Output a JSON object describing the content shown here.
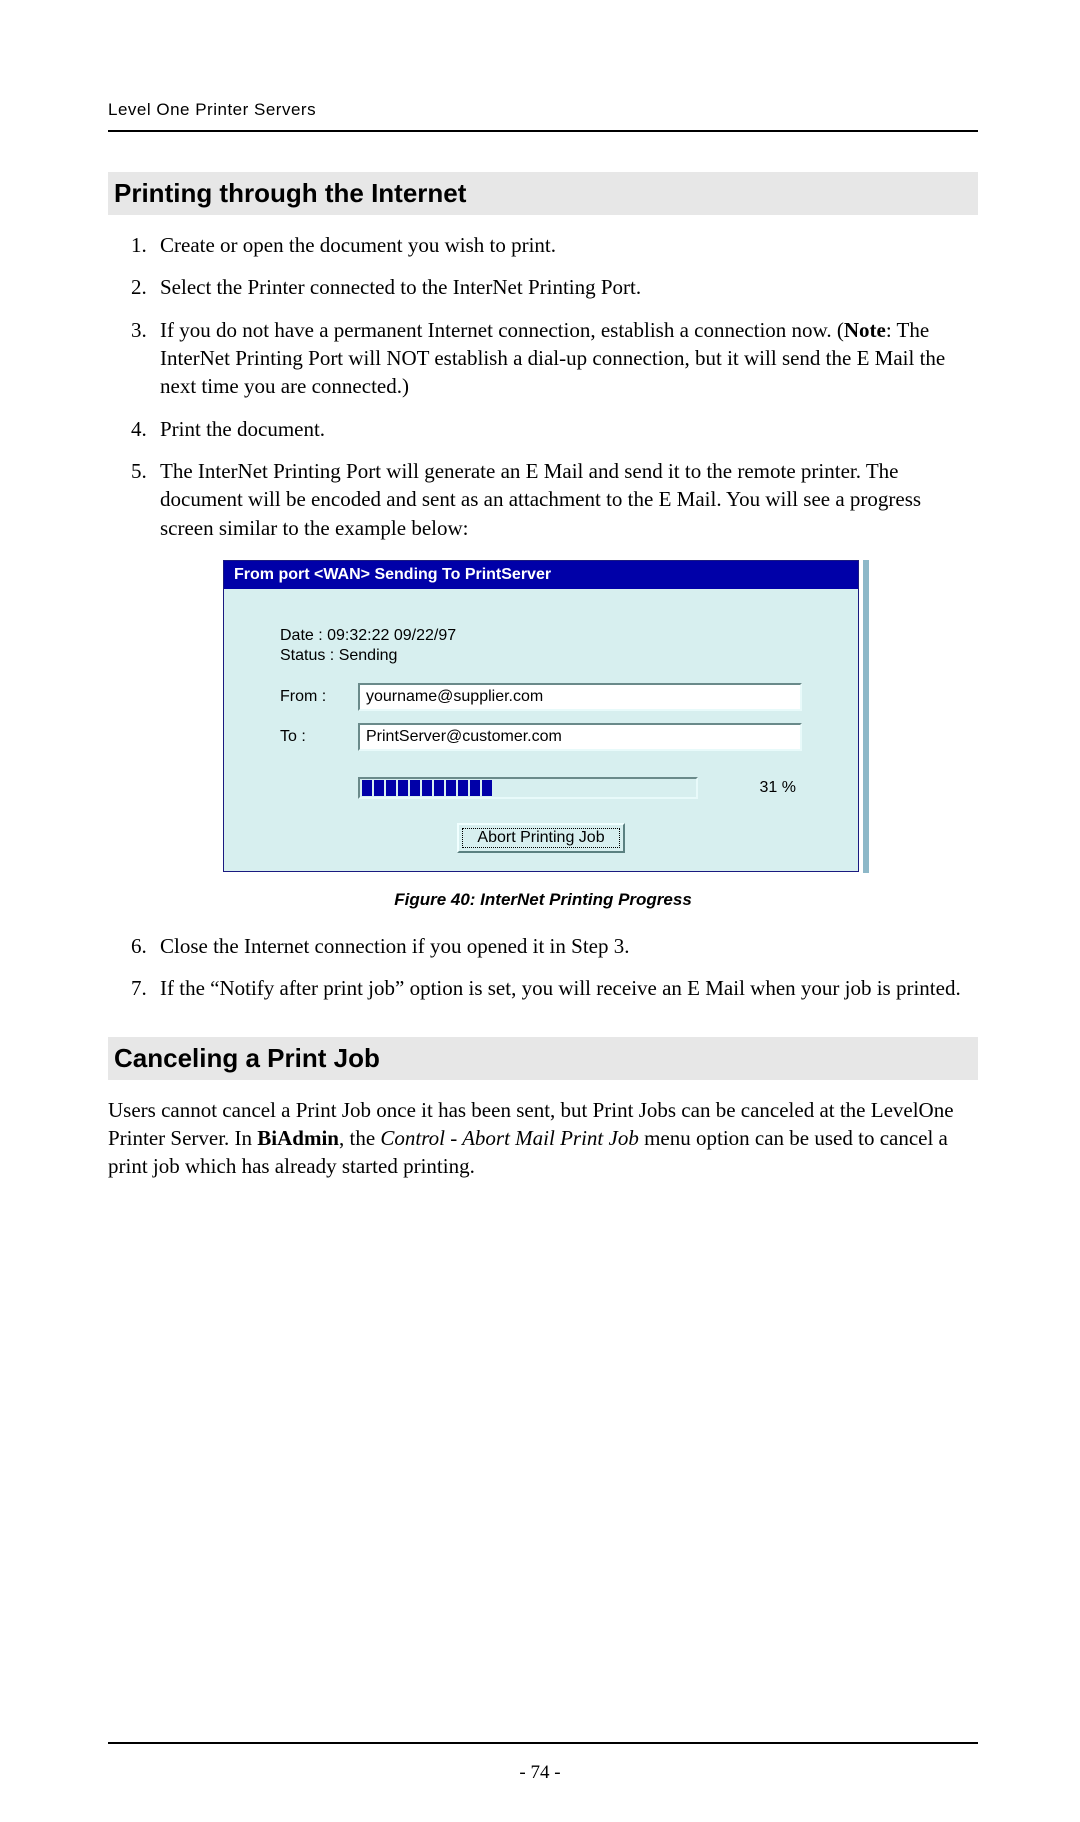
{
  "header": {
    "running": "Level One Printer Servers"
  },
  "section1": {
    "title": "Printing through the Internet",
    "steps_a": [
      "Create or open the document you wish to print.",
      "Select the Printer connected to the InterNet Printing Port.",
      {
        "pre": "If you do not have a permanent Internet connection, establish a connection now. (",
        "bold": "Note",
        "post": ": The InterNet Printing Port will NOT establish a dial-up connection, but it will send the E Mail the next time you are connected.)"
      },
      "Print the document.",
      "The InterNet Printing Port will generate an E Mail and send it to the remote printer. The document will be encoded and sent as an attachment to the E Mail. You will see a progress screen similar to the example below:"
    ],
    "steps_b": [
      "Close the Internet connection if you opened it in Step 3.",
      "If the “Notify after print job” option is set, you will receive an E Mail when your job is printed."
    ],
    "steps_b_start": 6
  },
  "dialog": {
    "title": "From port <WAN> Sending To PrintServer",
    "date_line": "Date : 09:32:22 09/22/97",
    "status_line": "Status : Sending",
    "from_label": "From :",
    "from_value": "yourname@supplier.com",
    "to_label": "To :",
    "to_value": "PrintServer@customer.com",
    "progress_percent": "31 %",
    "progress_segments": 11,
    "abort_label": "Abort Printing Job"
  },
  "figure": {
    "caption": "Figure 40: InterNet Printing Progress"
  },
  "section2": {
    "title": "Canceling a Print Job",
    "para": {
      "pre": "Users cannot cancel a Print Job once it has been sent, but Print Jobs can be canceled at the LevelOne Printer Server. In ",
      "b1": "BiAdmin",
      "mid": ", the ",
      "i1": "Control - Abort Mail Print Job",
      "post": " menu option can be used to cancel a print job which has already started printing."
    }
  },
  "footer": {
    "page": "- 74 -"
  }
}
